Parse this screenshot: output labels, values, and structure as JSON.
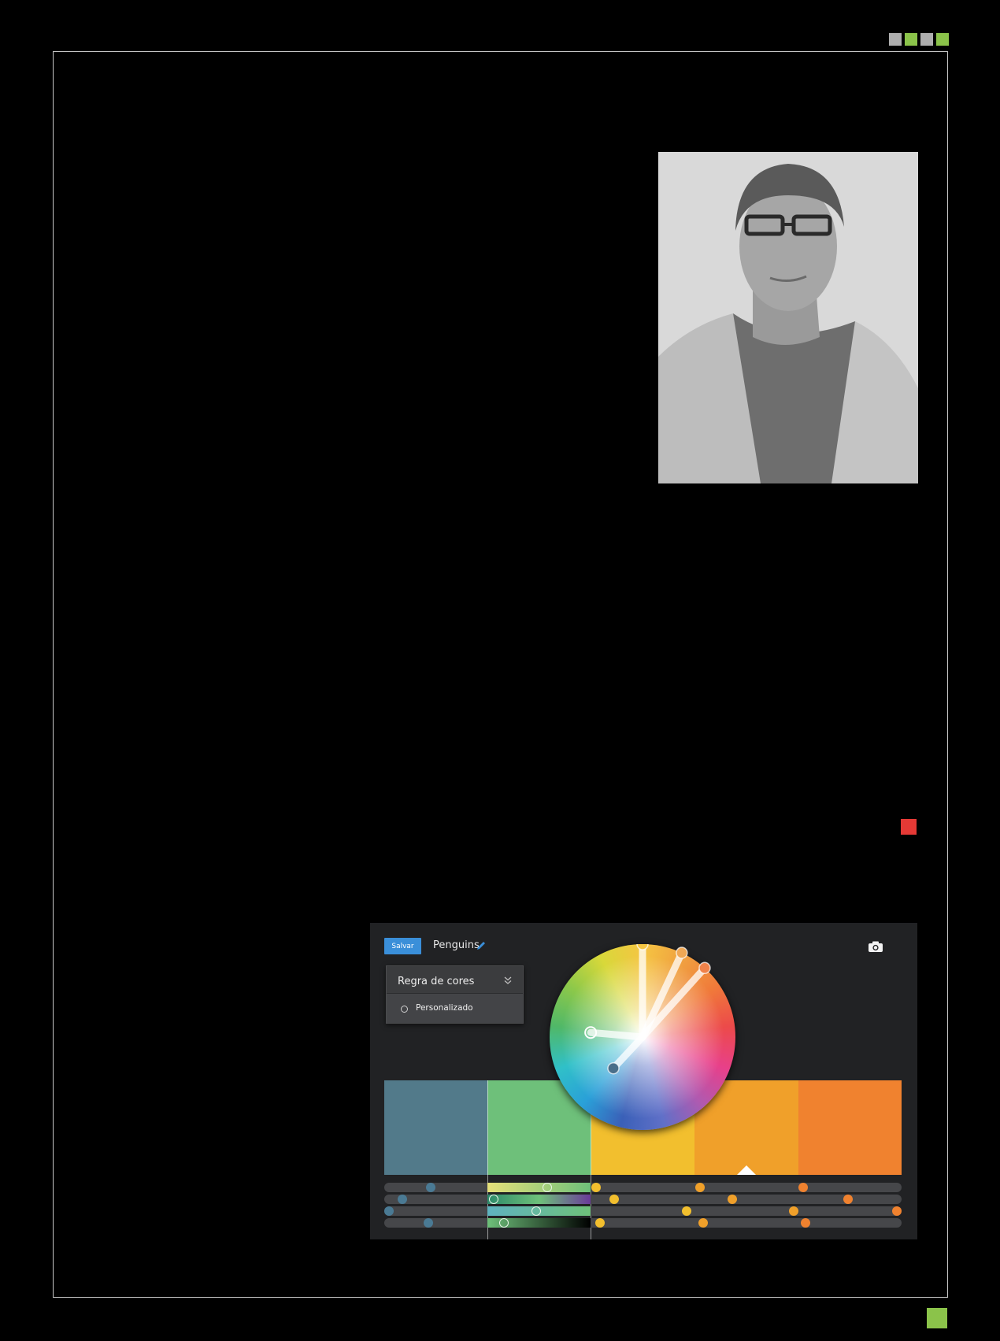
{
  "page": {
    "corner_squares": [
      "#aeaeae",
      "#8bc34a",
      "#aeaeae",
      "#8bc34a"
    ],
    "red_marker_color": "#e53935",
    "footer_square_color": "#8bc34a",
    "portrait_alt": "portrait-photo"
  },
  "app": {
    "save_label": "Salvar",
    "save_color": "#3a8fd9",
    "theme_name": "Penguins",
    "rule_title": "Regra de cores",
    "rule_option": "Personalizado",
    "swatches": [
      "#527a8a",
      "#6ec07a",
      "#f2bf2e",
      "#f0a02a",
      "#f0822f"
    ],
    "selected_swatch_index": 3,
    "slider_rows": [
      {
        "handles": [
          {
            "pos": 0.09,
            "color": "#4a7a94"
          },
          {
            "pos": 0.315,
            "color": "ring"
          },
          {
            "pos": 0.41,
            "color": "#f2bf2e"
          },
          {
            "pos": 0.61,
            "color": "#f0a02a"
          },
          {
            "pos": 0.81,
            "color": "#f0822f"
          }
        ]
      },
      {
        "handles": [
          {
            "pos": 0.035,
            "color": "#4a7a94"
          },
          {
            "pos": 0.212,
            "color": "ring"
          },
          {
            "pos": 0.445,
            "color": "#f2bf2e"
          },
          {
            "pos": 0.673,
            "color": "#f0a02a"
          },
          {
            "pos": 0.896,
            "color": "#f0822f"
          }
        ]
      },
      {
        "handles": [
          {
            "pos": 0.009,
            "color": "#4a7a94"
          },
          {
            "pos": 0.293,
            "color": "ring"
          },
          {
            "pos": 0.585,
            "color": "#f2bf2e"
          },
          {
            "pos": 0.792,
            "color": "#f0a02a"
          },
          {
            "pos": 0.991,
            "color": "#f0822f"
          }
        ]
      },
      {
        "handles": [
          {
            "pos": 0.085,
            "color": "#4a7a94"
          },
          {
            "pos": 0.232,
            "color": "ring"
          },
          {
            "pos": 0.417,
            "color": "#f2bf2e"
          },
          {
            "pos": 0.617,
            "color": "#f0a02a"
          },
          {
            "pos": 0.815,
            "color": "#f0822f"
          }
        ]
      }
    ],
    "slider_gradients": [
      "linear-gradient(90deg,#e6e07a,#6ec07a)",
      "linear-gradient(90deg,#2e8a6a,#6ec07a,#6b3a9a)",
      "linear-gradient(90deg,#5fb3c0,#6ec07a)",
      "linear-gradient(90deg,#6ec07a,#000)"
    ],
    "wheel_handles": [
      {
        "angle_deg": -90,
        "radius": 1.0,
        "color": "#f5c542"
      },
      {
        "angle_deg": -65,
        "radius": 1.0,
        "color": "#f0a855"
      },
      {
        "angle_deg": -48,
        "radius": 1.0,
        "color": "#f0824a"
      },
      {
        "angle_deg": 185,
        "radius": 0.56,
        "color": "ring"
      },
      {
        "angle_deg": 133,
        "radius": 0.46,
        "color": "#4a6f8a"
      }
    ]
  }
}
